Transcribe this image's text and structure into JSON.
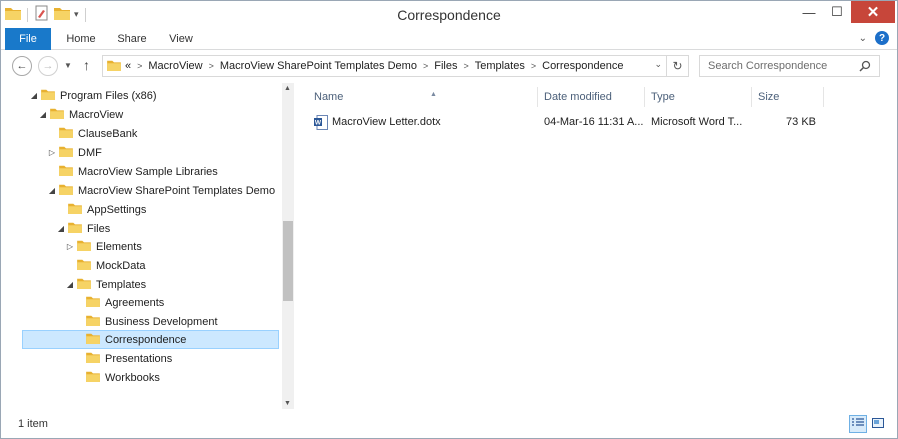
{
  "window": {
    "title": "Correspondence"
  },
  "ribbon": {
    "tabs": [
      "File",
      "Home",
      "Share",
      "View"
    ]
  },
  "addressbar": {
    "overflow": "«",
    "crumbs": [
      "MacroView",
      "MacroView SharePoint Templates Demo",
      "Files",
      "Templates",
      "Correspondence"
    ]
  },
  "search": {
    "placeholder": "Search Correspondence"
  },
  "tree": [
    {
      "label": "Program Files (x86)",
      "expanded": true
    },
    {
      "label": "MacroView",
      "expanded": true
    },
    {
      "label": "ClauseBank",
      "expanded": null
    },
    {
      "label": "DMF",
      "expanded": false
    },
    {
      "label": "MacroView Sample Libraries",
      "expanded": null
    },
    {
      "label": "MacroView SharePoint Templates Demo",
      "expanded": true
    },
    {
      "label": "AppSettings",
      "expanded": null
    },
    {
      "label": "Files",
      "expanded": true
    },
    {
      "label": "Elements",
      "expanded": false
    },
    {
      "label": "MockData",
      "expanded": null
    },
    {
      "label": "Templates",
      "expanded": true
    },
    {
      "label": "Agreements",
      "expanded": null
    },
    {
      "label": "Business Development",
      "expanded": null
    },
    {
      "label": "Correspondence",
      "expanded": null,
      "selected": true
    },
    {
      "label": "Presentations",
      "expanded": null
    },
    {
      "label": "Workbooks",
      "expanded": null
    }
  ],
  "columns": [
    "Name",
    "Date modified",
    "Type",
    "Size"
  ],
  "files": [
    {
      "name": "MacroView Letter.dotx",
      "date": "04-Mar-16 11:31 A...",
      "type": "Microsoft Word T...",
      "size": "73 KB"
    }
  ],
  "status": {
    "items": "1 item"
  },
  "colors": {
    "accent": "#1979ca",
    "close": "#c7463a",
    "folder": "#f2c744",
    "selection": "#cce8ff"
  }
}
